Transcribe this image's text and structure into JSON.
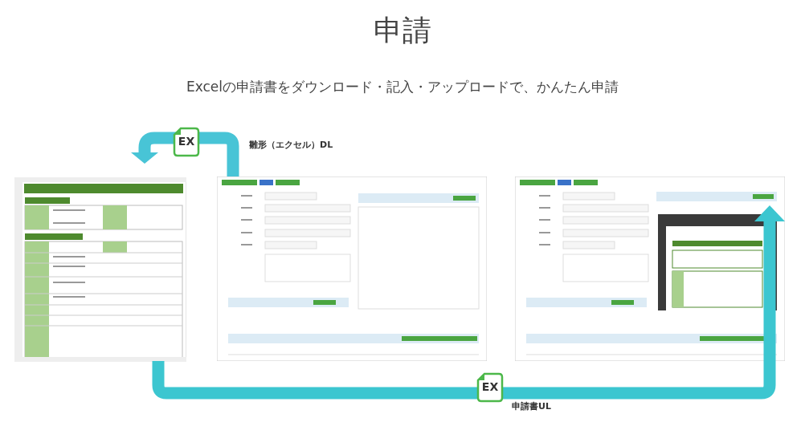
{
  "page": {
    "title": "申請",
    "subtitle": "Excelの申請書をダウンロード・記入・アップロードで、かんたん申請"
  },
  "steps": [
    {
      "kind": "download",
      "badge": "EX",
      "label": "雛形（エクセル）DL"
    },
    {
      "kind": "upload",
      "badge": "EX",
      "label": "申請書UL"
    }
  ],
  "screens": [
    {
      "kind": "spreadsheet"
    },
    {
      "kind": "form"
    },
    {
      "kind": "preview_form"
    }
  ]
}
